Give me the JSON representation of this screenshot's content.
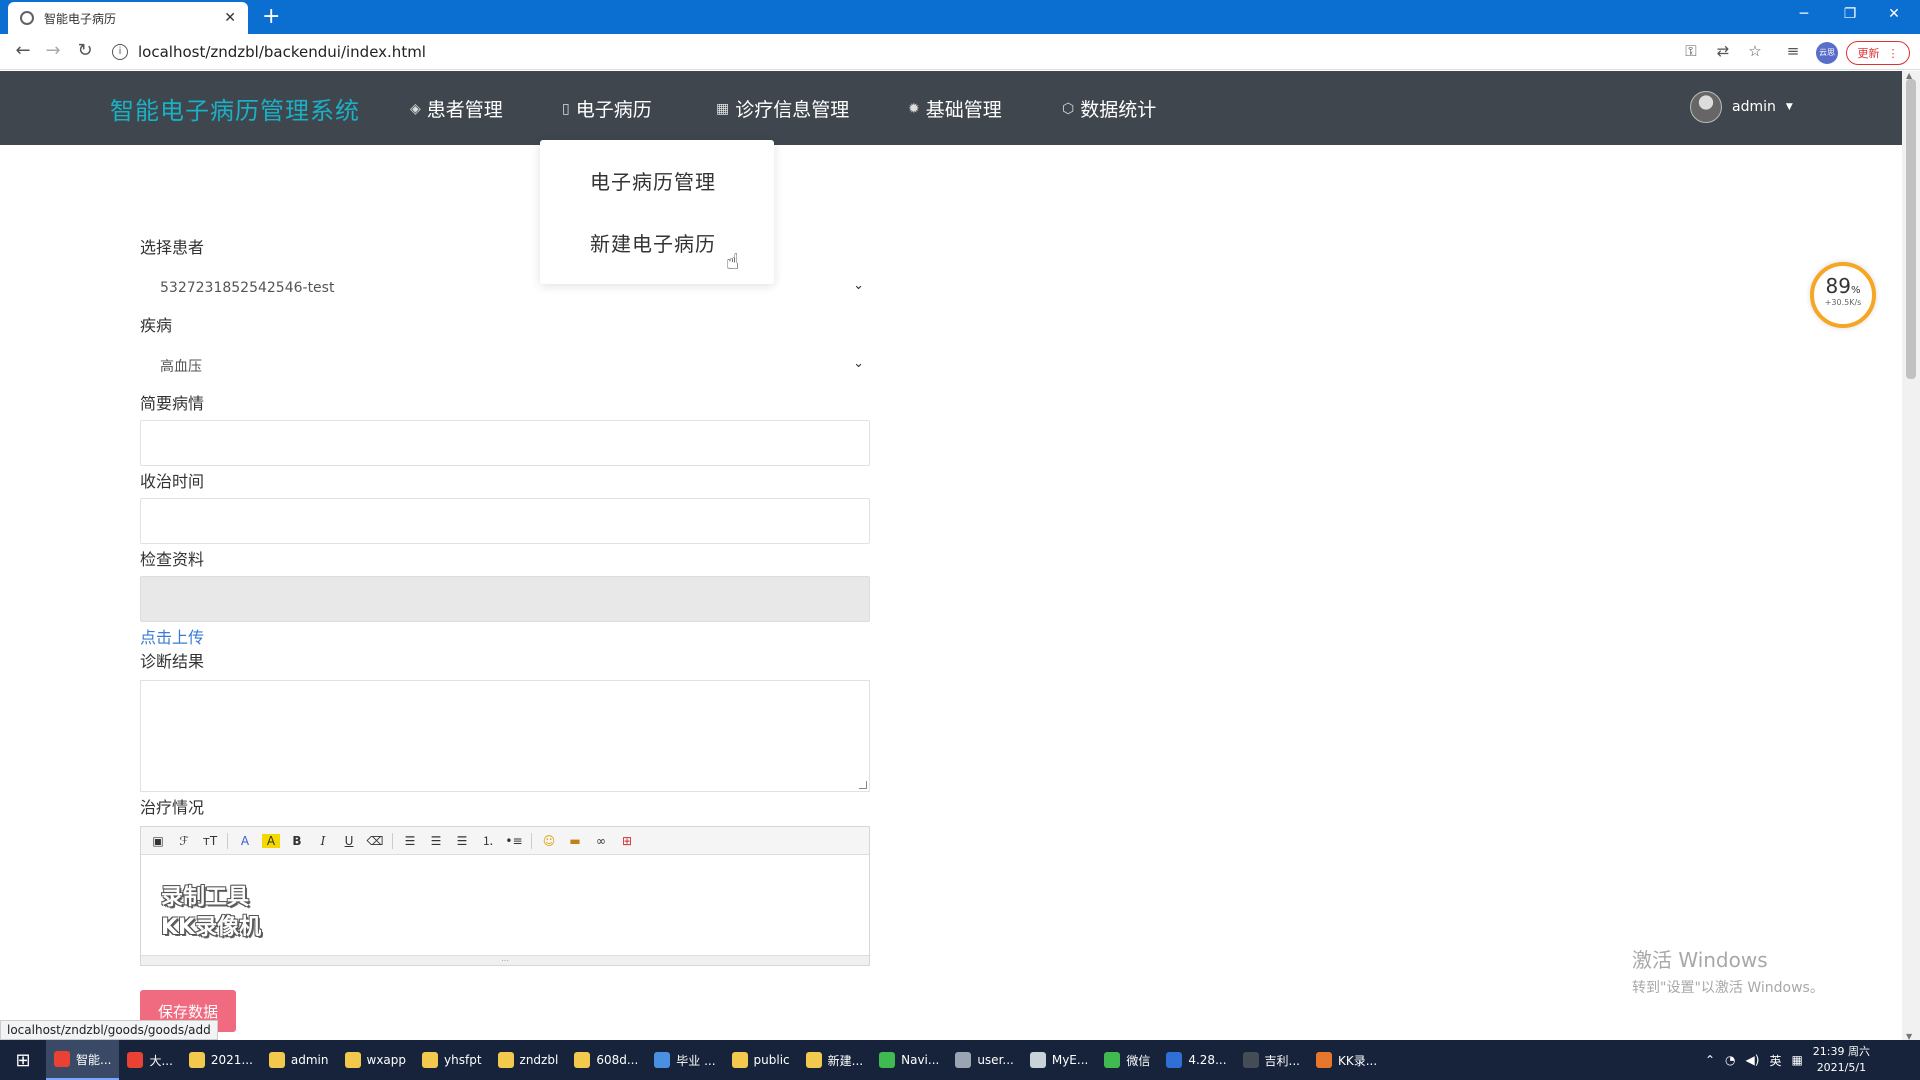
{
  "browser": {
    "tab_title": "智能电子病历",
    "new_tab": "+",
    "url": "localhost/zndzbl/backendui/index.html",
    "update_label": "更新",
    "profile_label": "云思",
    "status_url": "localhost/zndzbl/goods/goods/add"
  },
  "header": {
    "brand": "智能电子病历管理系统",
    "nav": [
      {
        "label": "患者管理",
        "icon": "layers-icon"
      },
      {
        "label": "电子病历",
        "icon": "bookmark-icon"
      },
      {
        "label": "诊疗信息管理",
        "icon": "grid-icon"
      },
      {
        "label": "基础管理",
        "icon": "gear-icon"
      },
      {
        "label": "数据统计",
        "icon": "cube-icon"
      }
    ],
    "user": "admin"
  },
  "dropdown": {
    "items": [
      "电子病历管理",
      "新建电子病历"
    ]
  },
  "form": {
    "patient_label": "选择患者",
    "patient_value": "5327231852542546-test",
    "disease_label": "疾病",
    "disease_value": "高血压",
    "summary_label": "简要病情",
    "admit_time_label": "收治时间",
    "exam_label": "检查资料",
    "upload_link": "点击上传",
    "diagnosis_label": "诊断结果",
    "treatment_label": "治疗情况",
    "save_button": "保存数据"
  },
  "editor": {
    "watermark_line1": "录制工具",
    "watermark_line2": "KK录像机"
  },
  "speed_widget": {
    "percent": "89",
    "percent_unit": "%",
    "rate": "+30.5K/s"
  },
  "activation": {
    "title": "激活 Windows",
    "subtitle": "转到\"设置\"以激活 Windows。"
  },
  "taskbar": {
    "items": [
      {
        "label": "智能...",
        "color": "#e94235"
      },
      {
        "label": "大...",
        "color": "#e94235"
      },
      {
        "label": "2021...",
        "color": "#f2c94c"
      },
      {
        "label": "admin",
        "color": "#f2c94c"
      },
      {
        "label": "wxapp",
        "color": "#f2c94c"
      },
      {
        "label": "yhsfpt",
        "color": "#f2c94c"
      },
      {
        "label": "zndzbl",
        "color": "#f2c94c"
      },
      {
        "label": "608d...",
        "color": "#f2c94c"
      },
      {
        "label": "毕业 ...",
        "color": "#4a90e2"
      },
      {
        "label": "public",
        "color": "#f2c94c"
      },
      {
        "label": "新建...",
        "color": "#f2c94c"
      },
      {
        "label": "Navi...",
        "color": "#3fb950"
      },
      {
        "label": "user...",
        "color": "#9aa4b2"
      },
      {
        "label": "MyE...",
        "color": "#c9d1d9"
      },
      {
        "label": "微信",
        "color": "#3fb950"
      },
      {
        "label": "4.28...",
        "color": "#2f6fd6"
      },
      {
        "label": "吉利...",
        "color": "#444c56"
      },
      {
        "label": "KK录...",
        "color": "#e8772e"
      }
    ],
    "tray_lang": "英",
    "time": "21:39 周六",
    "date": "2021/5/1"
  }
}
